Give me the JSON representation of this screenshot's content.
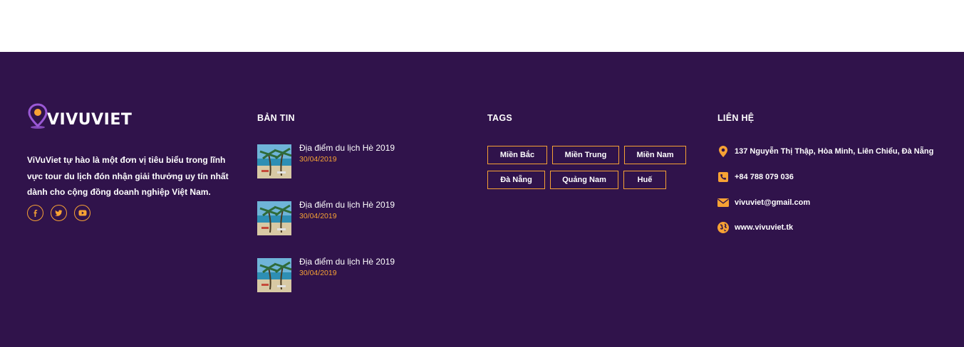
{
  "brand": {
    "name": "VIVUVIET",
    "accent_color": "#f7a234",
    "background_color": "#30134b"
  },
  "about": {
    "text": "ViVuViet tự hào là một đơn vị tiêu biểu trong lĩnh vực tour du lịch đón nhận giải thưởng uy tín nhất dành cho cộng đồng doanh nghiệp Việt Nam."
  },
  "social": [
    {
      "name": "facebook",
      "icon": "facebook-icon"
    },
    {
      "name": "twitter",
      "icon": "twitter-icon"
    },
    {
      "name": "youtube",
      "icon": "youtube-icon"
    }
  ],
  "news": {
    "title": "BẢN TIN",
    "items": [
      {
        "title": "Địa điểm du lịch Hè 2019",
        "date": "30/04/2019"
      },
      {
        "title": "Địa điểm du lịch Hè 2019",
        "date": "30/04/2019"
      },
      {
        "title": "Địa điểm du lịch Hè 2019",
        "date": "30/04/2019"
      }
    ]
  },
  "tags": {
    "title": "TAGS",
    "items": [
      "Miền Bắc",
      "Miền Trung",
      "Miền Nam",
      "Đà Nẵng",
      "Quảng Nam",
      "Huế"
    ]
  },
  "contact": {
    "title": "LIÊN HỆ",
    "address": "137 Nguyễn Thị Thập, Hòa Minh, Liên Chiểu, Đà Nẵng",
    "phone": "+84 788 079 036",
    "email": "vivuviet@gmail.com",
    "website": "www.vivuviet.tk"
  }
}
